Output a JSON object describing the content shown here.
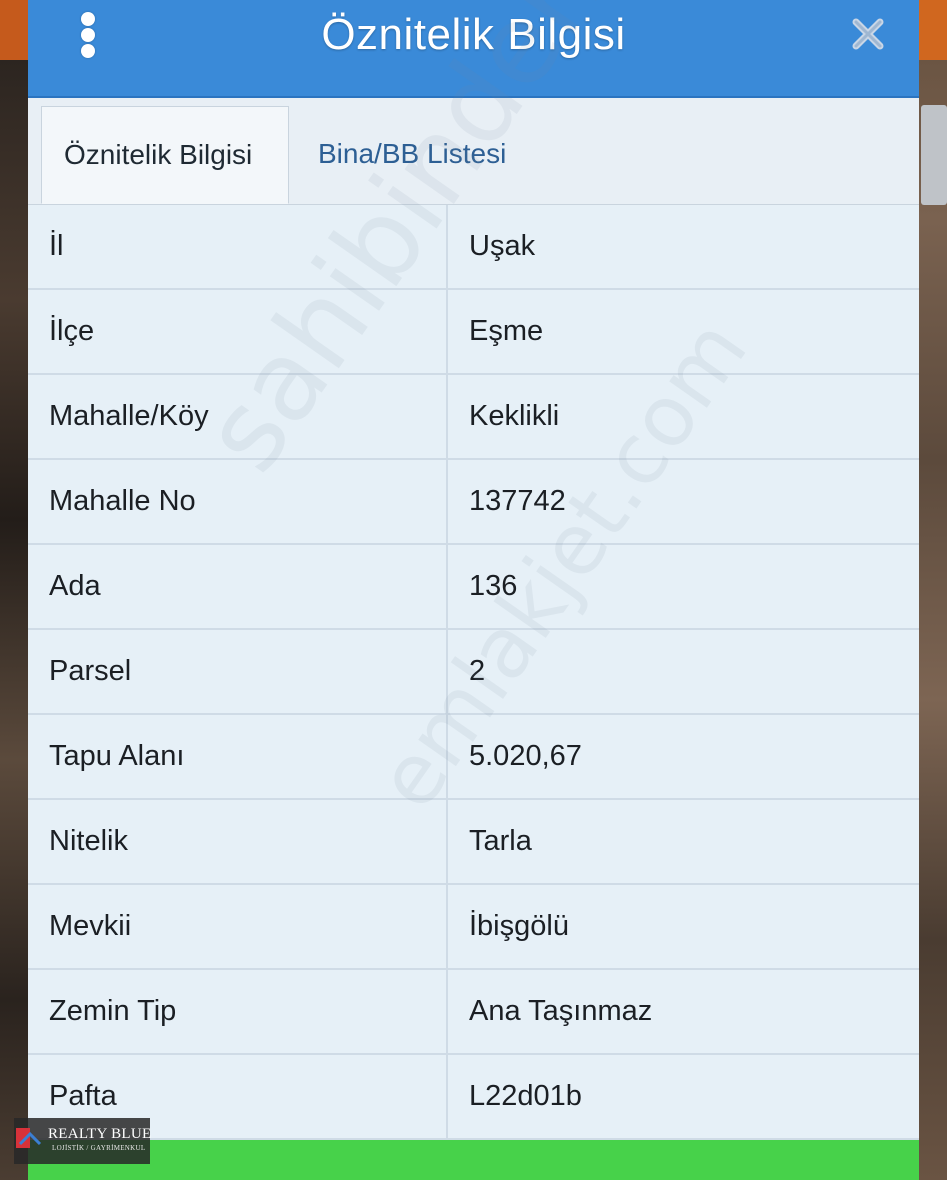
{
  "window": {
    "title": "Öznitelik Bilgisi"
  },
  "tabs": [
    {
      "label": "Öznitelik Bilgisi",
      "active": true
    },
    {
      "label": "Bina/BB Listesi",
      "active": false
    }
  ],
  "rows": [
    {
      "key": "İl",
      "value": "Uşak"
    },
    {
      "key": "İlçe",
      "value": "Eşme"
    },
    {
      "key": "Mahalle/Köy",
      "value": "Keklikli"
    },
    {
      "key": "Mahalle No",
      "value": "137742"
    },
    {
      "key": "Ada",
      "value": "136"
    },
    {
      "key": "Parsel",
      "value": "2"
    },
    {
      "key": "Tapu Alanı",
      "value": "5.020,67"
    },
    {
      "key": "Nitelik",
      "value": "Tarla"
    },
    {
      "key": "Mevkii",
      "value": "İbişgölü"
    },
    {
      "key": "Zemin Tip",
      "value": "Ana Taşınmaz"
    },
    {
      "key": "Pafta",
      "value": "L22d01b"
    }
  ],
  "watermark": {
    "line1": "sahibinden",
    "line2": "emlakjet.com"
  },
  "logo": {
    "brand": "REALTY BLUE",
    "tagline": "LOJİSTİK / GAYRİMENKUL"
  },
  "colors": {
    "titlebar": "#3a8ad8",
    "tab_inactive_text": "#2d5f94",
    "footer_bar": "#47d24a"
  },
  "icons": {
    "menu": "vertical-dots-icon",
    "close": "close-icon"
  }
}
